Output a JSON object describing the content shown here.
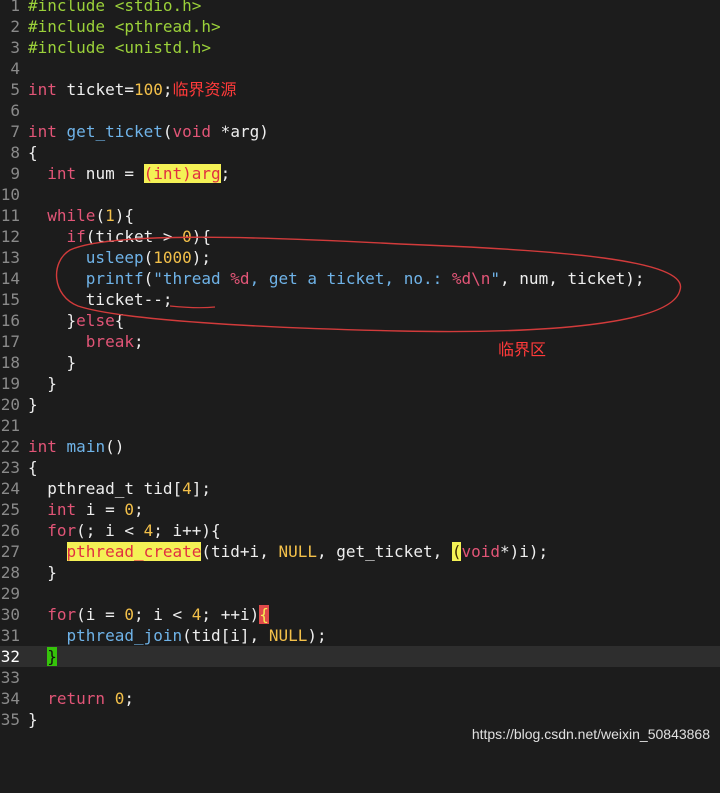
{
  "code_lines": [
    {
      "n": "1",
      "text": "#include <stdio.h>"
    },
    {
      "n": "2",
      "text": "#include <pthread.h>"
    },
    {
      "n": "3",
      "text": "#include <unistd.h>"
    },
    {
      "n": "4",
      "text": ""
    },
    {
      "n": "5",
      "text": "int ticket=100;"
    },
    {
      "n": "6",
      "text": ""
    },
    {
      "n": "7",
      "text": "int get_ticket(void *arg)"
    },
    {
      "n": "8",
      "text": "{"
    },
    {
      "n": "9",
      "text": "  int num = (int)arg;"
    },
    {
      "n": "10",
      "text": ""
    },
    {
      "n": "11",
      "text": "  while(1){"
    },
    {
      "n": "12",
      "text": "    if(ticket > 0){"
    },
    {
      "n": "13",
      "text": "      usleep(1000);"
    },
    {
      "n": "14",
      "text": "      printf(\"thread %d, get a ticket, no.: %d\\n\", num, ticket);"
    },
    {
      "n": "15",
      "text": "      ticket--;"
    },
    {
      "n": "16",
      "text": "    }else{"
    },
    {
      "n": "17",
      "text": "      break;"
    },
    {
      "n": "18",
      "text": "    }"
    },
    {
      "n": "19",
      "text": "  }"
    },
    {
      "n": "20",
      "text": "}"
    },
    {
      "n": "21",
      "text": ""
    },
    {
      "n": "22",
      "text": "int main()"
    },
    {
      "n": "23",
      "text": "{"
    },
    {
      "n": "24",
      "text": "  pthread_t tid[4];"
    },
    {
      "n": "25",
      "text": "  int i = 0;"
    },
    {
      "n": "26",
      "text": "  for(; i < 4; i++){"
    },
    {
      "n": "27",
      "text": "    pthread_create(tid+i, NULL, get_ticket, (void*)i);"
    },
    {
      "n": "28",
      "text": "  }"
    },
    {
      "n": "29",
      "text": ""
    },
    {
      "n": "30",
      "text": "  for(i = 0; i < 4; ++i){"
    },
    {
      "n": "31",
      "text": "    pthread_join(tid[i], NULL);"
    },
    {
      "n": "32",
      "text": "  }"
    },
    {
      "n": "33",
      "text": ""
    },
    {
      "n": "34",
      "text": "  return 0;"
    },
    {
      "n": "35",
      "text": "}"
    }
  ],
  "current_line": "32",
  "annotations": {
    "resource_label": "临界资源",
    "section_label": "临界区"
  },
  "watermark": "https://blog.csdn.net/weixin_50843868",
  "colors": {
    "background": "#1c1c1c",
    "keyword": "#e25577",
    "function": "#6fb3e8",
    "preprocessor": "#9bd13a",
    "number": "#f3c04a",
    "annotation": "#ff3a3a"
  }
}
